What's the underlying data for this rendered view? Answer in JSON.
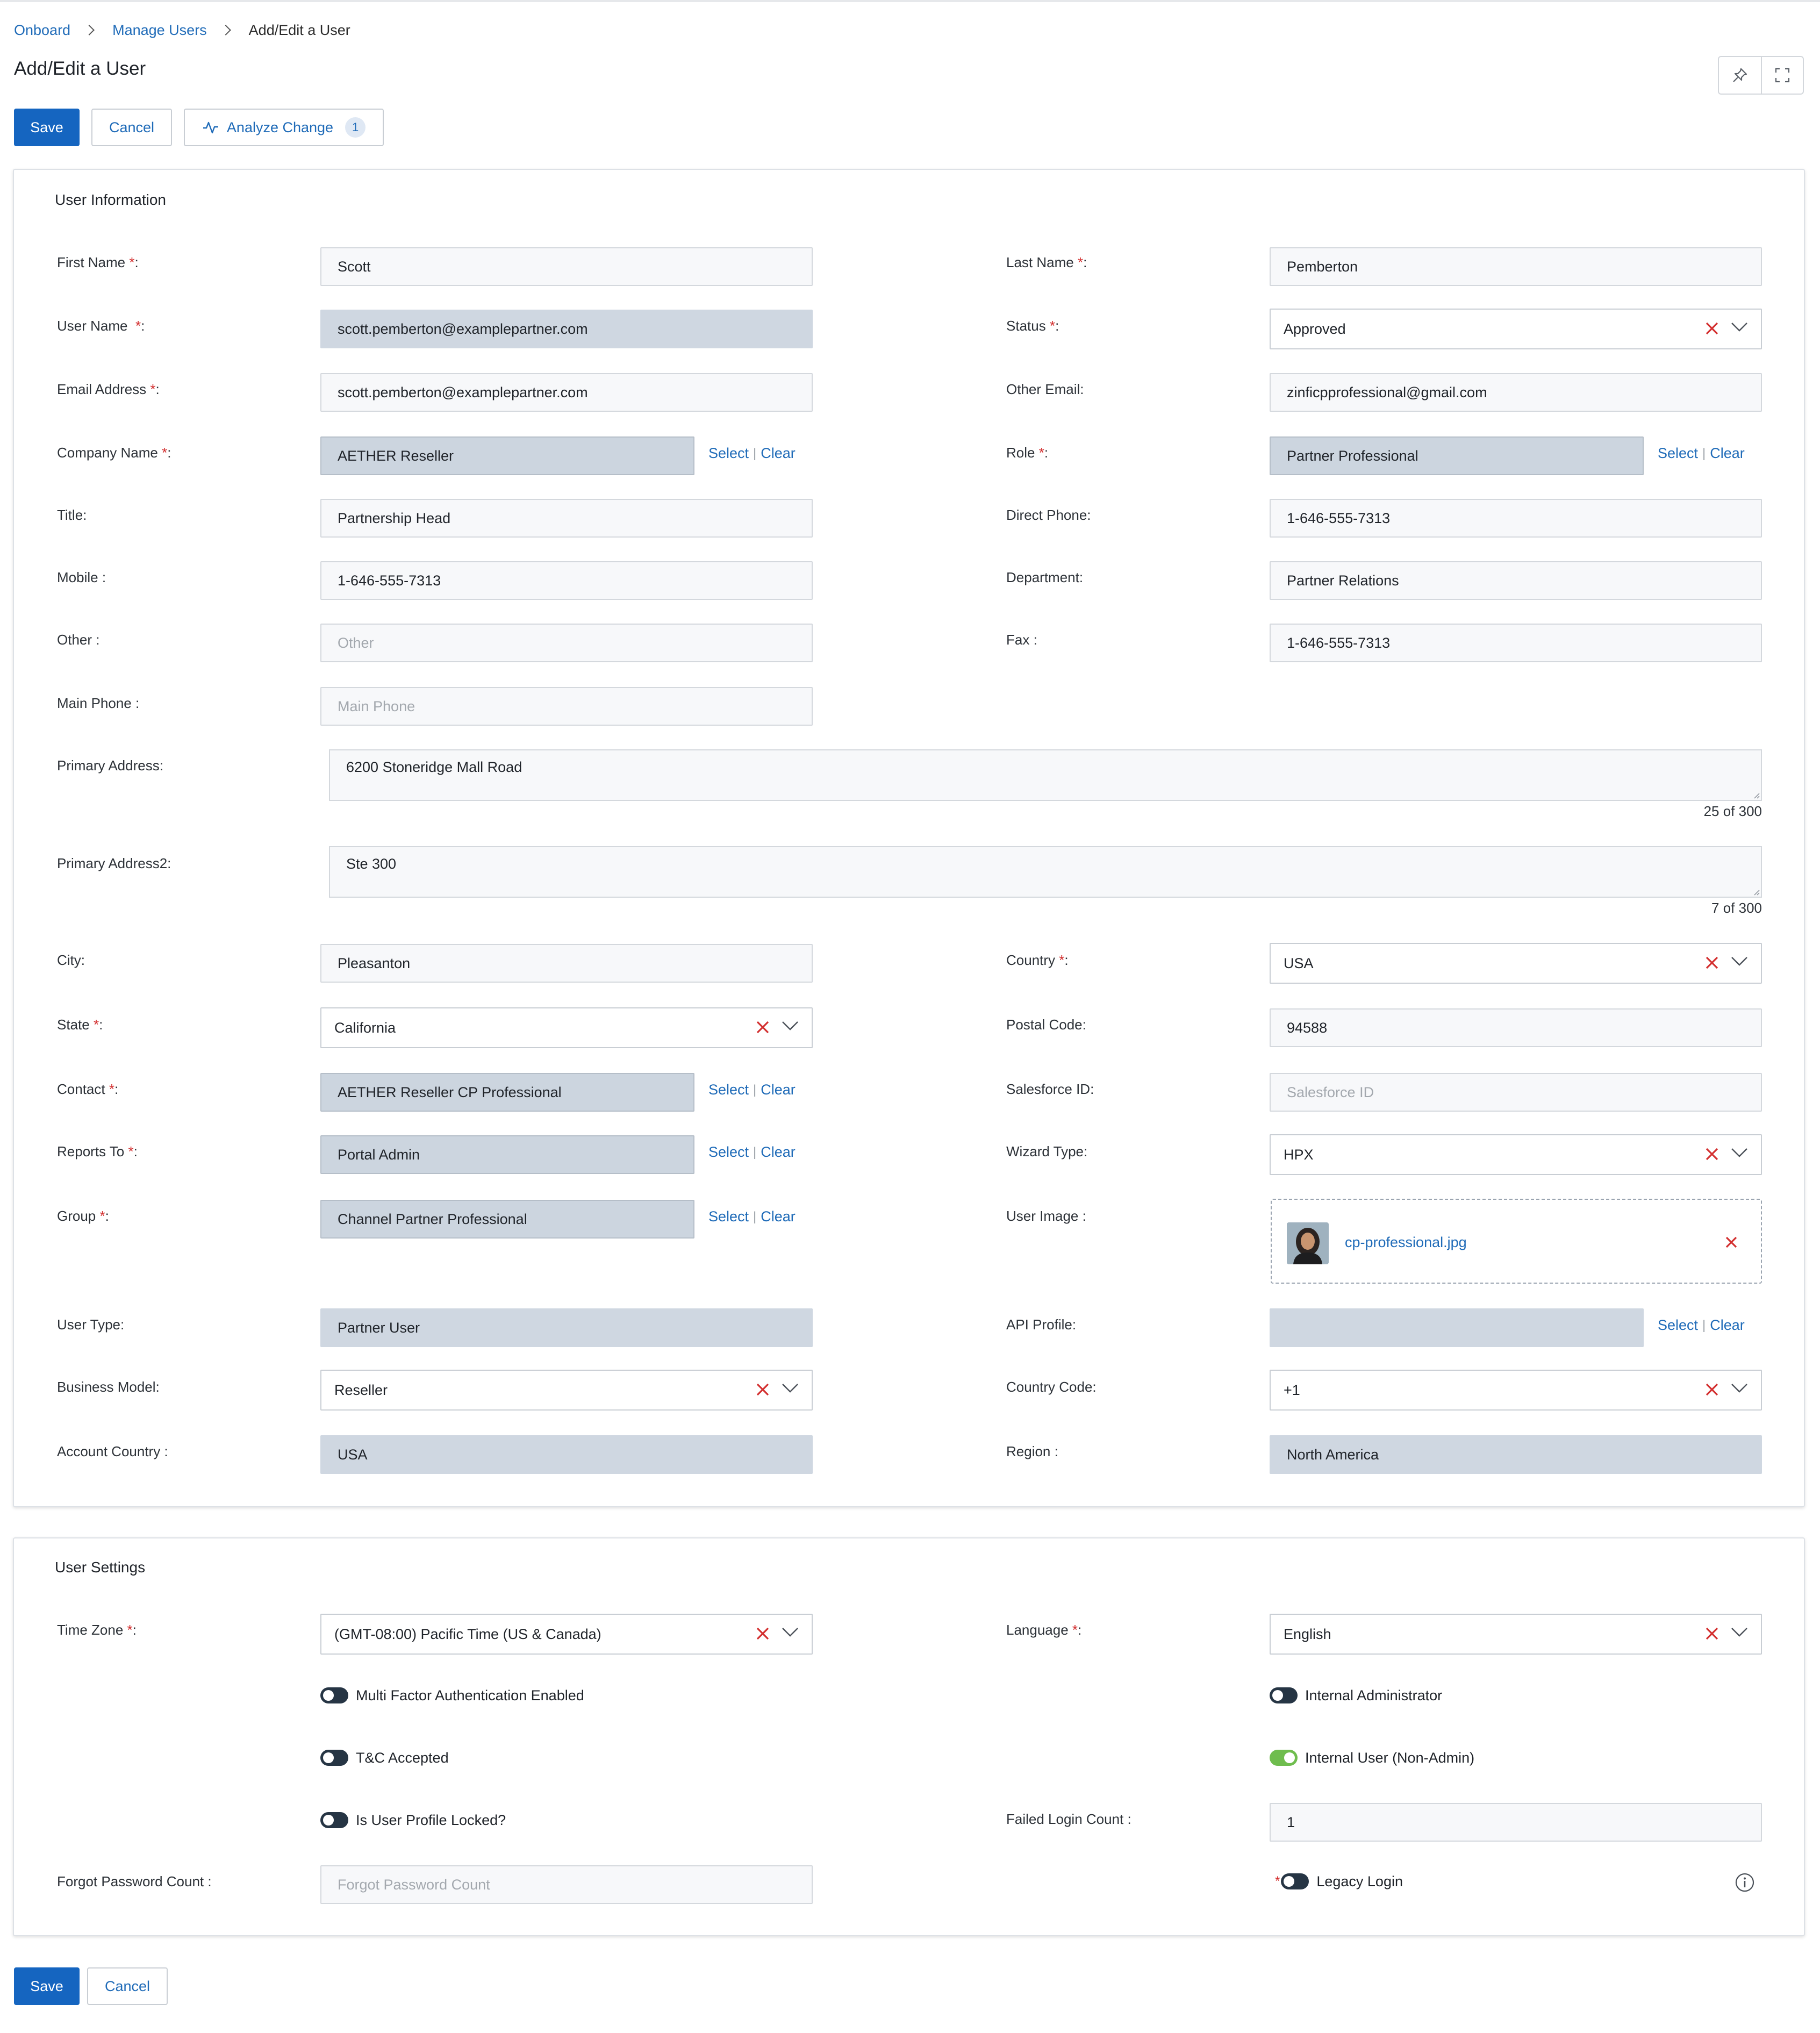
{
  "breadcrumb": {
    "items": [
      "Onboard",
      "Manage Users"
    ],
    "current": "Add/Edit a User"
  },
  "page": {
    "title": "Add/Edit a User"
  },
  "toolbar": {
    "save_label": "Save",
    "cancel_label": "Cancel",
    "analyze_label": "Analyze Change",
    "analyze_count": "1"
  },
  "user_information": {
    "title": "User Information",
    "first_name_label": "First Name",
    "first_name": "Scott",
    "last_name_label": "Last Name",
    "last_name": "Pemberton",
    "user_name_label": "User Name",
    "user_name": "scott.pemberton@examplepartner.com",
    "status_label": "Status",
    "status": "Approved",
    "email_label": "Email Address",
    "email": "scott.pemberton@examplepartner.com",
    "other_email_label": "Other Email:",
    "other_email": "zinficpprofessional@gmail.com",
    "company_label": "Company Name",
    "company": "AETHER Reseller",
    "role_label": "Role",
    "role": "Partner Professional",
    "title_label": "Title:",
    "title_value": "Partnership Head",
    "direct_phone_label": "Direct Phone:",
    "direct_phone": "1-646-555-7313",
    "mobile_label": "Mobile :",
    "mobile": "1-646-555-7313",
    "department_label": "Department:",
    "department": "Partner Relations",
    "other_label": "Other :",
    "other_placeholder": "Other",
    "fax_label": "Fax :",
    "fax": "1-646-555-7313",
    "main_phone_label": "Main Phone :",
    "main_phone_placeholder": "Main Phone",
    "primary_address_label": "Primary Address:",
    "primary_address": "6200 Stoneridge Mall Road",
    "primary_address_count": "25 of 300",
    "primary_address2_label": "Primary Address2:",
    "primary_address2": "Ste 300",
    "primary_address2_count": "7 of 300",
    "city_label": "City:",
    "city": "Pleasanton",
    "country_label": "Country",
    "country": "USA",
    "state_label": "State",
    "state": "California",
    "postal_label": "Postal Code:",
    "postal": "94588",
    "contact_label": "Contact",
    "contact": "AETHER Reseller CP Professional",
    "salesforce_label": "Salesforce ID:",
    "salesforce_placeholder": "Salesforce ID",
    "reports_to_label": "Reports To",
    "reports_to": "Portal Admin",
    "wizard_label": "Wizard Type:",
    "wizard": "HPX",
    "group_label": "Group",
    "group": "Channel Partner Professional",
    "user_image_label": "User Image :",
    "user_image_file": "cp-professional.jpg",
    "user_type_label": "User Type:",
    "user_type": "Partner User",
    "api_profile_label": "API Profile:",
    "api_profile": "",
    "business_model_label": "Business Model:",
    "business_model": "Reseller",
    "country_code_label": "Country Code:",
    "country_code": "+1",
    "account_country_label": "Account Country :",
    "account_country": "USA",
    "region_label": "Region :",
    "region": "North America",
    "select_label": "Select",
    "clear_label": "Clear",
    "req_marker": "*",
    "req_suffix": ":"
  },
  "user_settings": {
    "title": "User Settings",
    "time_zone_label": "Time Zone",
    "time_zone": "(GMT-08:00) Pacific Time (US & Canada)",
    "language_label": "Language",
    "language": "English",
    "mfa_label": "Multi Factor Authentication Enabled",
    "mfa_enabled": false,
    "internal_admin_label": "Internal Administrator",
    "internal_admin": false,
    "tc_label": "T&C Accepted",
    "tc_accepted": false,
    "internal_user_label": "Internal User (Non-Admin)",
    "internal_user": true,
    "locked_label": "Is User Profile Locked?",
    "locked": false,
    "failed_login_label": "Failed Login Count :",
    "failed_login": "1",
    "forgot_password_label": "Forgot Password Count :",
    "forgot_password_placeholder": "Forgot Password Count",
    "legacy_login_label": "Legacy Login",
    "legacy_login": false
  },
  "footer": {
    "save_label": "Save",
    "cancel_label": "Cancel"
  },
  "colors": {
    "primary": "#1565c0",
    "link": "#1f6bb8",
    "required": "#d32f2f",
    "toggle_off": "#263544",
    "toggle_on": "#6fbd4e"
  },
  "icons": [
    "pin-icon",
    "expand-icon",
    "activity-icon",
    "clear-x-icon",
    "chevron-down-icon",
    "info-icon"
  ]
}
